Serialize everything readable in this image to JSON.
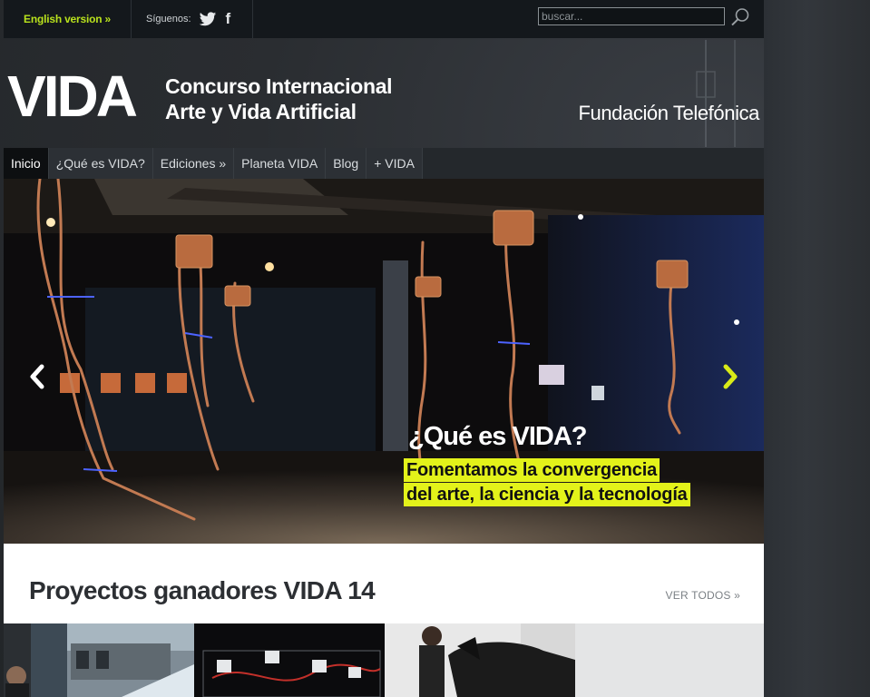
{
  "topbar": {
    "english_link": "English version »",
    "follow_label": "Síguenos:",
    "search_placeholder": "buscar..."
  },
  "header": {
    "brand": "VIDA",
    "tagline_line1": "Concurso Internacional",
    "tagline_line2": "Arte y Vida Artificial",
    "foundation": "Fundación Telefónica"
  },
  "nav": {
    "items": [
      {
        "label": "Inicio",
        "active": true
      },
      {
        "label": "¿Qué es VIDA?"
      },
      {
        "label": "Ediciones »"
      },
      {
        "label": "Planeta VIDA"
      },
      {
        "label": "Blog"
      },
      {
        "label": "+ VIDA"
      }
    ]
  },
  "hero": {
    "title": "¿Qué es VIDA?",
    "subtitle_line1": "Fomentamos la convergencia",
    "subtitle_line2": "del arte, la ciencia y la tecnología"
  },
  "section": {
    "title": "Proyectos ganadores VIDA 14",
    "see_all": "VER TODOS »"
  },
  "colors": {
    "accent": "#e3f21a",
    "link_green": "#b9e21c",
    "topbar_bg": "#14181c",
    "nav_bg": "#2c3035"
  },
  "icons": [
    "twitter-icon",
    "facebook-icon",
    "search-icon",
    "chevron-left-icon",
    "chevron-right-icon"
  ]
}
